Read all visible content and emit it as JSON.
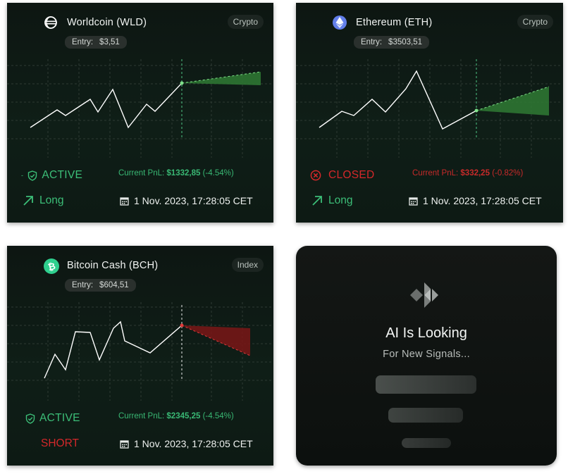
{
  "cards": [
    {
      "coin_name": "Worldcoin (WLD)",
      "icon": "worldcoin-icon",
      "category": "Crypto",
      "entry_label": "Entry:",
      "entry_value": "$3,51",
      "status": "ACTIVE",
      "pnl_label": "Current PnL:",
      "pnl_value": "$1332,85",
      "pnl_change": "(-4.54%)",
      "side": "Long",
      "datetime": "1 Nov. 2023, 17:28:05 CET"
    },
    {
      "coin_name": "Ethereum (ETH)",
      "icon": "ethereum-icon",
      "category": "Crypto",
      "entry_label": "Entry:",
      "entry_value": "$3503,51",
      "status": "CLOSED",
      "pnl_label": "Current PnL:",
      "pnl_value": "$332,25",
      "pnl_change": "(-0.82%)",
      "side": "Long",
      "datetime": "1 Nov. 2023, 17:28:05 CET"
    },
    {
      "coin_name": "Bitcoin Cash (BCH)",
      "icon": "bitcoin-cash-icon",
      "category": "Index",
      "entry_label": "Entry:",
      "entry_value": "$604,51",
      "status": "ACTIVE",
      "pnl_label": "Current PnL:",
      "pnl_value": "$2345,25",
      "pnl_change": "(-4.54%)",
      "side": "SHORT",
      "datetime": "1 Nov. 2023, 17:28:05 CET"
    }
  ],
  "ai_panel": {
    "title": "AI Is Looking",
    "subtitle": "For New Signals..."
  },
  "colors": {
    "positive": "#3cbf78",
    "negative": "#d4282a",
    "card_bg": "#0f1e17",
    "ethereum": "#627eea",
    "bitcoin_cash": "#2fcf8e"
  }
}
